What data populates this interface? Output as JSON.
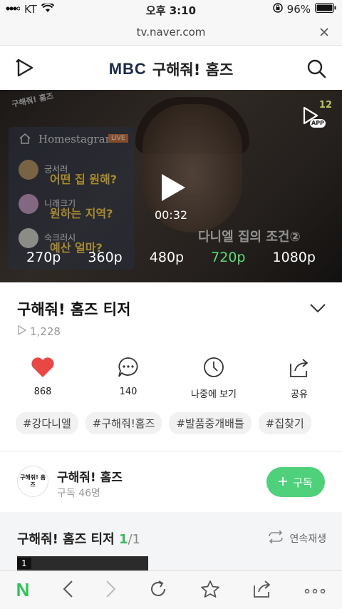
{
  "status_bar": {
    "carrier": "KT",
    "time": "오후 3:10",
    "battery": "96%"
  },
  "browser": {
    "url": "tv.naver.com"
  },
  "header": {
    "brand": "MBC",
    "show_title": "구해줘! 홈즈"
  },
  "player": {
    "logo_text": "구해줘! 홈즈",
    "overlay_panel_title": "Homestagram",
    "live_badge": "LIVE",
    "chat": [
      {
        "user": "궁서러",
        "message": "어떤 집 원해?"
      },
      {
        "user": "니래크기",
        "message": "원하는 지역?"
      },
      {
        "user": "숙크러시",
        "message": "예산 얼마?"
      }
    ],
    "caption": "다니엘 집의 조건②",
    "channel_number": "12",
    "app_label": "APP",
    "time": "00:32",
    "qualities": [
      "270p",
      "360p",
      "480p",
      "720p",
      "1080p"
    ],
    "selected_quality": "720p"
  },
  "video_info": {
    "title": "구해줘! 홈즈 티저",
    "views": "1,228",
    "actions": [
      {
        "icon": "heart-icon",
        "label": "868"
      },
      {
        "icon": "comment-icon",
        "label": "140"
      },
      {
        "icon": "clock-icon",
        "label": "나중에 보기"
      },
      {
        "icon": "share-icon",
        "label": "공유"
      }
    ],
    "tags": [
      "#강다니엘",
      "#구해줘!홈즈",
      "#발품중개배틀",
      "#집찾기"
    ]
  },
  "channel": {
    "thumb_text": "구해줘! 홈즈",
    "name": "구해줘! 홈즈",
    "subscribers": "구독 46명",
    "subscribe_label": "구독"
  },
  "playlist": {
    "title": "구해줘! 홈즈 티저",
    "current": "1",
    "total": "/1",
    "continuous_play": "연속재생",
    "first_item_number": "1"
  },
  "colors": {
    "accent_green": "#4fd07a",
    "heart_red": "#e94646",
    "selected_quality": "#5ddb7a"
  }
}
